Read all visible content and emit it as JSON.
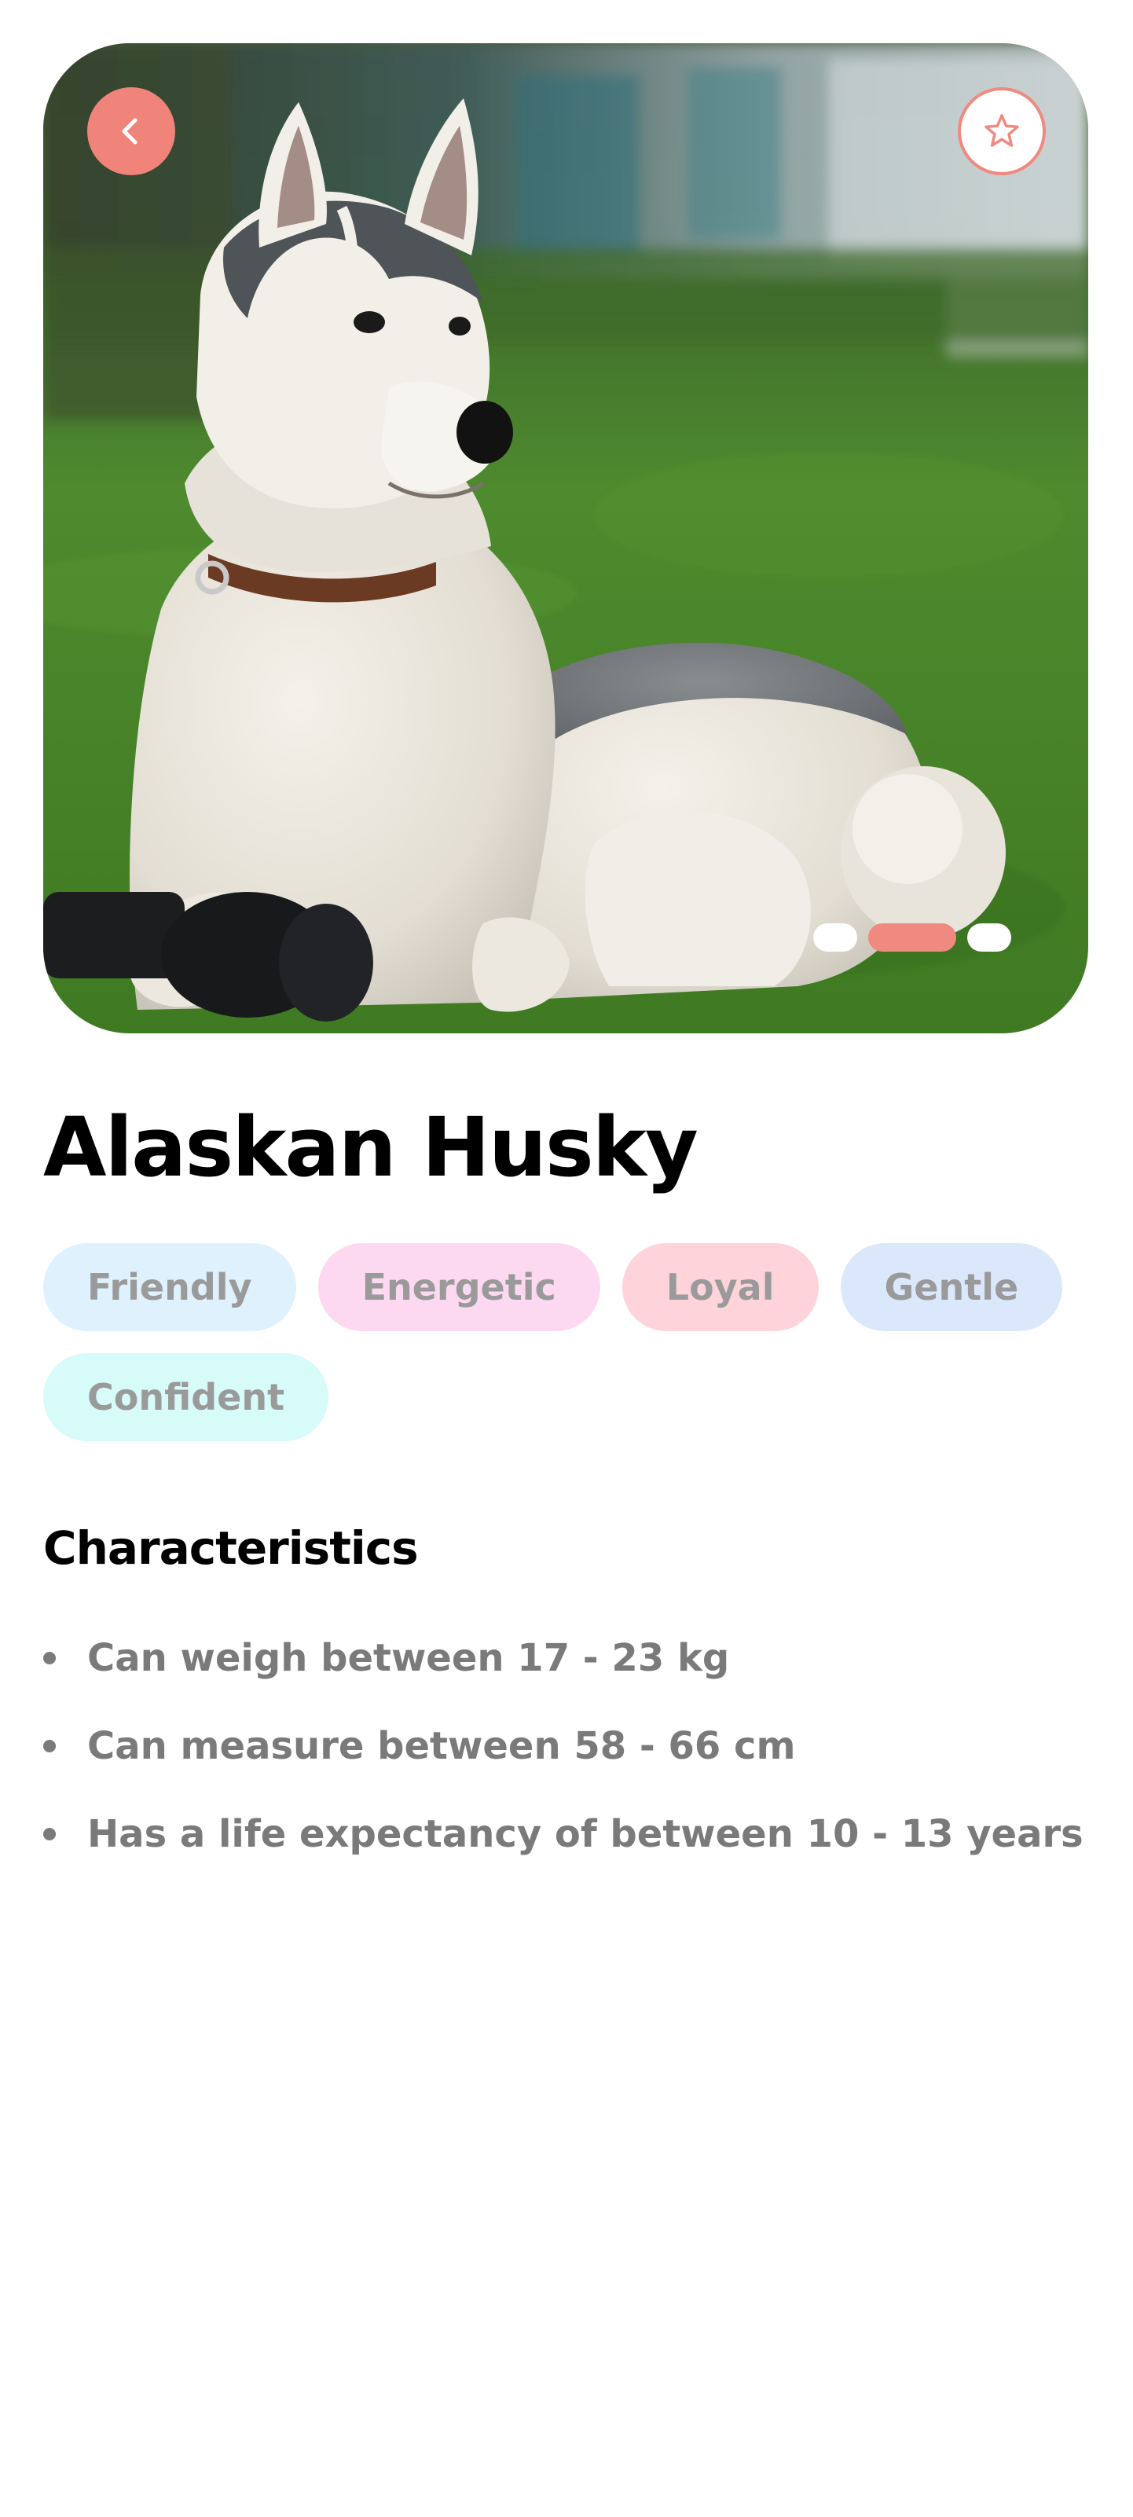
{
  "hero": {
    "photo_subject": "Alaskan husky lying on grass",
    "back_icon": "chevron-left-icon",
    "favorite_icon": "star-outline-icon",
    "carousel": {
      "count": 3,
      "active_index": 1
    }
  },
  "breed": {
    "name": "Alaskan Husky"
  },
  "tags": [
    {
      "label": "Friendly",
      "color": "#dff1fc"
    },
    {
      "label": "Energetic",
      "color": "#fdd9f1"
    },
    {
      "label": "Loyal",
      "color": "#ffd3da"
    },
    {
      "label": "Gentle",
      "color": "#dbe8fc"
    },
    {
      "label": "Confident",
      "color": "#d6fbf9"
    }
  ],
  "characteristics": {
    "title": "Characteristics",
    "items": [
      "Can weigh between 17 - 23 kg",
      "Can measure between 58 - 66 cm",
      "Has a life expectancy of between 10 - 13 years"
    ]
  },
  "colors": {
    "accent": "#f08a80",
    "text_primary": "#000000",
    "text_muted": "#7a7a7a",
    "tag_text": "#9a9a9a"
  }
}
